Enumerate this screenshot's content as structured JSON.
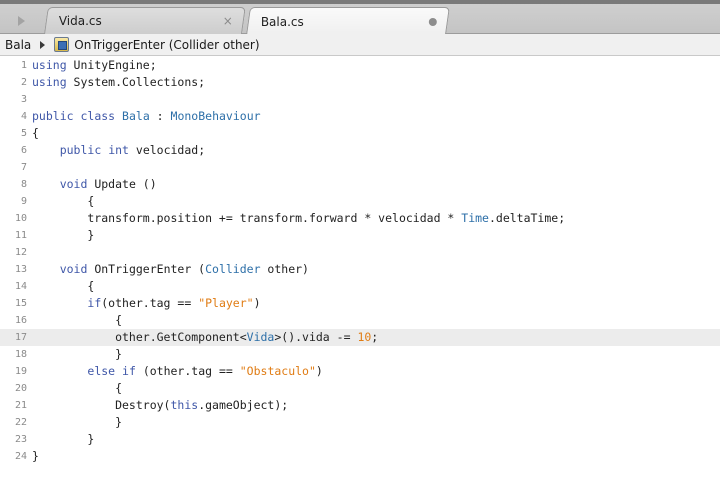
{
  "tabs": [
    {
      "label": "Vida.cs",
      "close_glyph": "×"
    },
    {
      "label": "Bala.cs",
      "status_icon": "modified-dot-icon"
    }
  ],
  "tab_scroll_icon": "play-arrow-icon",
  "breadcrumb": {
    "class_name": "Bala",
    "separator_icon": "chevron-right-icon",
    "member_icon": "method-icon",
    "member_name": "OnTriggerEnter (Collider other)"
  },
  "editor": {
    "current_line": 17,
    "lines": [
      {
        "n": "1",
        "tokens": [
          [
            "kw",
            "using"
          ],
          [
            "pl",
            " UnityEngine;"
          ]
        ]
      },
      {
        "n": "2",
        "tokens": [
          [
            "kw",
            "using"
          ],
          [
            "pl",
            " System.Collections;"
          ]
        ]
      },
      {
        "n": "3",
        "tokens": []
      },
      {
        "n": "4",
        "tokens": [
          [
            "kw",
            "public"
          ],
          [
            "pl",
            " "
          ],
          [
            "kw",
            "class"
          ],
          [
            "pl",
            " "
          ],
          [
            "ty",
            "Bala"
          ],
          [
            "pl",
            " : "
          ],
          [
            "ty",
            "MonoBehaviour"
          ]
        ]
      },
      {
        "n": "5",
        "tokens": [
          [
            "pl",
            "{"
          ]
        ]
      },
      {
        "n": "6",
        "tokens": [
          [
            "pl",
            "    "
          ],
          [
            "kw",
            "public"
          ],
          [
            "pl",
            " "
          ],
          [
            "kw",
            "int"
          ],
          [
            "pl",
            " velocidad;"
          ]
        ]
      },
      {
        "n": "7",
        "tokens": []
      },
      {
        "n": "8",
        "tokens": [
          [
            "pl",
            "    "
          ],
          [
            "kw",
            "void"
          ],
          [
            "pl",
            " Update ()"
          ]
        ]
      },
      {
        "n": "9",
        "tokens": [
          [
            "pl",
            "        {"
          ]
        ]
      },
      {
        "n": "10",
        "tokens": [
          [
            "pl",
            "        transform.position += transform.forward * velocidad * "
          ],
          [
            "ty",
            "Time"
          ],
          [
            "pl",
            ".deltaTime;"
          ]
        ]
      },
      {
        "n": "11",
        "tokens": [
          [
            "pl",
            "        }"
          ]
        ]
      },
      {
        "n": "12",
        "tokens": []
      },
      {
        "n": "13",
        "tokens": [
          [
            "pl",
            "    "
          ],
          [
            "kw",
            "void"
          ],
          [
            "pl",
            " OnTriggerEnter ("
          ],
          [
            "ty",
            "Collider"
          ],
          [
            "pl",
            " other)"
          ]
        ]
      },
      {
        "n": "14",
        "tokens": [
          [
            "pl",
            "        {"
          ]
        ]
      },
      {
        "n": "15",
        "tokens": [
          [
            "pl",
            "        "
          ],
          [
            "kw",
            "if"
          ],
          [
            "pl",
            "(other.tag == "
          ],
          [
            "st",
            "\"Player\""
          ],
          [
            "pl",
            ")"
          ]
        ]
      },
      {
        "n": "16",
        "tokens": [
          [
            "pl",
            "            {"
          ]
        ]
      },
      {
        "n": "17",
        "tokens": [
          [
            "pl",
            "            other.GetComponent<"
          ],
          [
            "ty",
            "Vida"
          ],
          [
            "pl",
            ">().vida -= "
          ],
          [
            "nu",
            "10"
          ],
          [
            "pl",
            ";"
          ]
        ]
      },
      {
        "n": "18",
        "tokens": [
          [
            "pl",
            "            }"
          ]
        ]
      },
      {
        "n": "19",
        "tokens": [
          [
            "pl",
            "        "
          ],
          [
            "kw",
            "else"
          ],
          [
            "pl",
            " "
          ],
          [
            "kw",
            "if"
          ],
          [
            "pl",
            " (other.tag == "
          ],
          [
            "st",
            "\"Obstaculo\""
          ],
          [
            "pl",
            ")"
          ]
        ]
      },
      {
        "n": "20",
        "tokens": [
          [
            "pl",
            "            {"
          ]
        ]
      },
      {
        "n": "21",
        "tokens": [
          [
            "pl",
            "            Destroy("
          ],
          [
            "kw",
            "this"
          ],
          [
            "pl",
            ".gameObject);"
          ]
        ]
      },
      {
        "n": "22",
        "tokens": [
          [
            "pl",
            "            }"
          ]
        ]
      },
      {
        "n": "23",
        "tokens": [
          [
            "pl",
            "        }"
          ]
        ]
      },
      {
        "n": "24",
        "tokens": [
          [
            "pl",
            "}"
          ]
        ]
      }
    ]
  }
}
